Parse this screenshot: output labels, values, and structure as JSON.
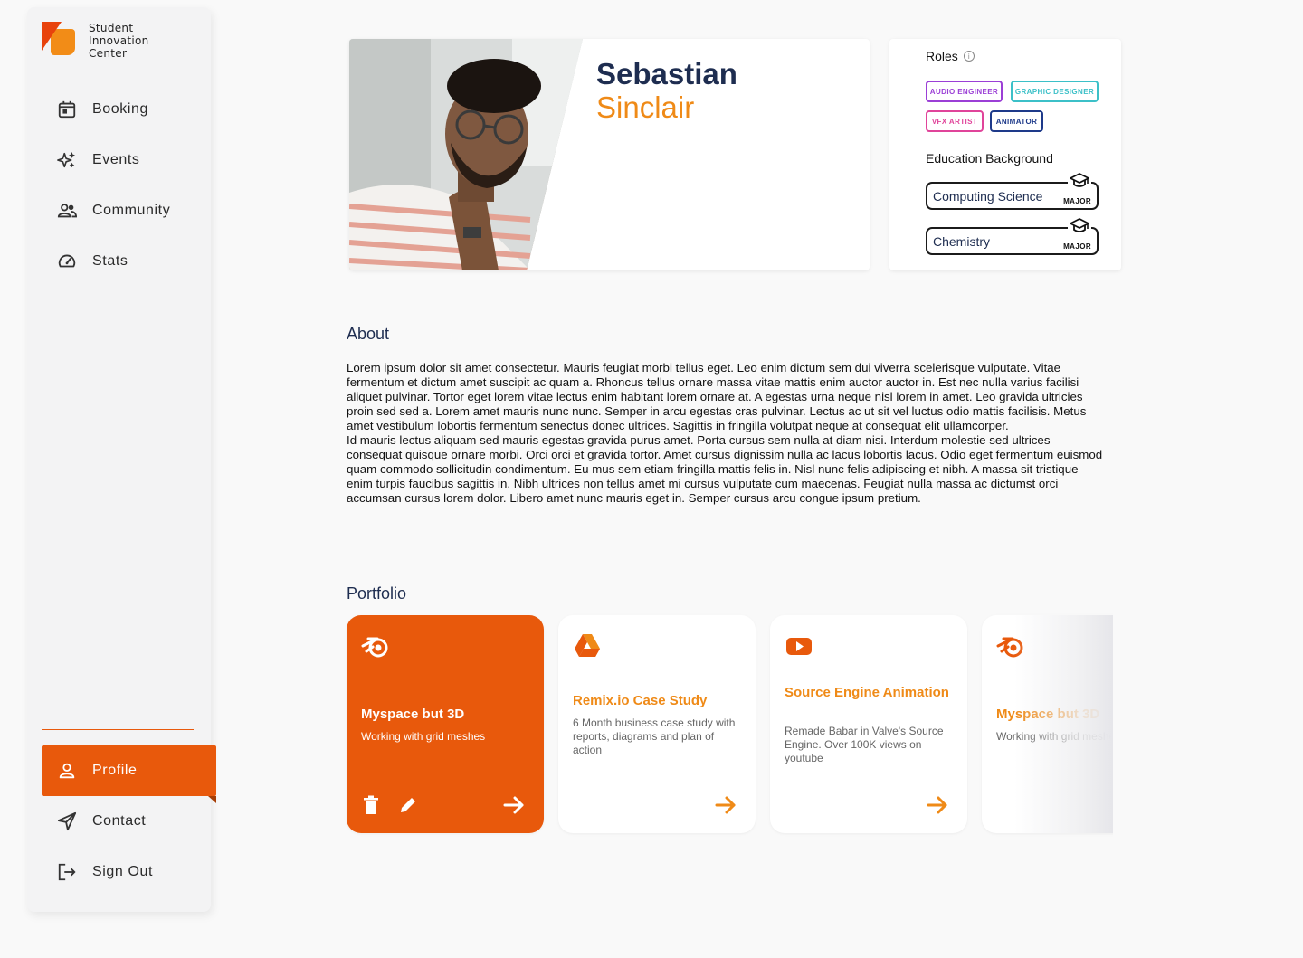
{
  "sidebar": {
    "logo_text": [
      "Student",
      "Innovation",
      "Center"
    ],
    "items": [
      {
        "label": "Booking",
        "icon": "calendar-icon"
      },
      {
        "label": "Events",
        "icon": "sparkle-icon"
      },
      {
        "label": "Community",
        "icon": "people-icon"
      },
      {
        "label": "Stats",
        "icon": "speedometer-icon"
      }
    ],
    "bottom_items": [
      {
        "label": "Profile",
        "icon": "person-icon",
        "active": true
      },
      {
        "label": "Contact",
        "icon": "send-icon"
      },
      {
        "label": "Sign Out",
        "icon": "logout-icon"
      }
    ]
  },
  "profile": {
    "first_name": "Sebastian",
    "last_name": "Sinclair"
  },
  "roles": {
    "title": "Roles",
    "chips": [
      {
        "label": "AUDIO ENGINEER",
        "color": "#9b3fd6"
      },
      {
        "label": "GRAPHIC DESIGNER",
        "color": "#3cc0c8"
      },
      {
        "label": "VFX ARTIST",
        "color": "#e0449a"
      },
      {
        "label": "ANIMATOR",
        "color": "#1e3a8a"
      }
    ],
    "education_title": "Education Background",
    "education": [
      {
        "field": "Computing Science",
        "tag": "MAJOR"
      },
      {
        "field": "Chemistry",
        "tag": "MAJOR"
      }
    ]
  },
  "about": {
    "title": "About",
    "p1": "Lorem ipsum dolor sit amet consectetur. Mauris feugiat morbi tellus eget. Leo enim dictum sem dui viverra scelerisque vulputate. Vitae fermentum et dictum amet suscipit ac quam a. Rhoncus tellus ornare massa vitae mattis enim auctor auctor in. Est nec nulla varius facilisi aliquet pulvinar. Tortor eget lorem vitae lectus enim habitant lorem ornare at. A egestas urna neque nisl lorem in amet. Leo gravida ultricies proin sed sed a. Lorem amet mauris nunc nunc. Semper in arcu egestas cras pulvinar. Lectus ac ut sit vel luctus odio mattis facilisis. Metus amet vestibulum lobortis fermentum senectus donec ultrices. Sagittis in fringilla volutpat neque at consequat elit ullamcorper.",
    "p2": "Id mauris lectus aliquam sed mauris egestas gravida purus amet. Porta cursus sem nulla at diam nisi. Interdum molestie sed ultrices consequat quisque ornare morbi. Orci orci et gravida tortor. Amet cursus dignissim nulla ac lacus lobortis lacus. Odio eget fermentum euismod quam commodo sollicitudin condimentum. Eu mus sem etiam fringilla mattis felis in. Nisl nunc felis adipiscing et nibh. A massa sit tristique enim turpis faucibus sagittis in. Nibh ultrices non tellus amet mi cursus vulputate cum maecenas. Feugiat nulla massa ac dictumst orci accumsan cursus lorem dolor. Libero amet nunc mauris eget in. Semper cursus arcu congue ipsum pretium."
  },
  "portfolio": {
    "title": "Portfolio",
    "cards": [
      {
        "icon": "blender-icon",
        "title": "Myspace but 3D",
        "desc": "Working with grid meshes"
      },
      {
        "icon": "google-drive-icon",
        "title": "Remix.io Case Study",
        "desc": "6 Month business case study with reports, diagrams and plan of action"
      },
      {
        "icon": "youtube-icon",
        "title": "Source Engine Animation",
        "desc": "Remade Babar in Valve's Source Engine. Over 100K views on youtube"
      },
      {
        "icon": "blender-icon",
        "title": "Myspace but 3D",
        "desc": "Working with grid meshes"
      }
    ]
  },
  "colors": {
    "accent": "#e8590c",
    "accent_light": "#ef8a17",
    "navy": "#1e2d50"
  }
}
